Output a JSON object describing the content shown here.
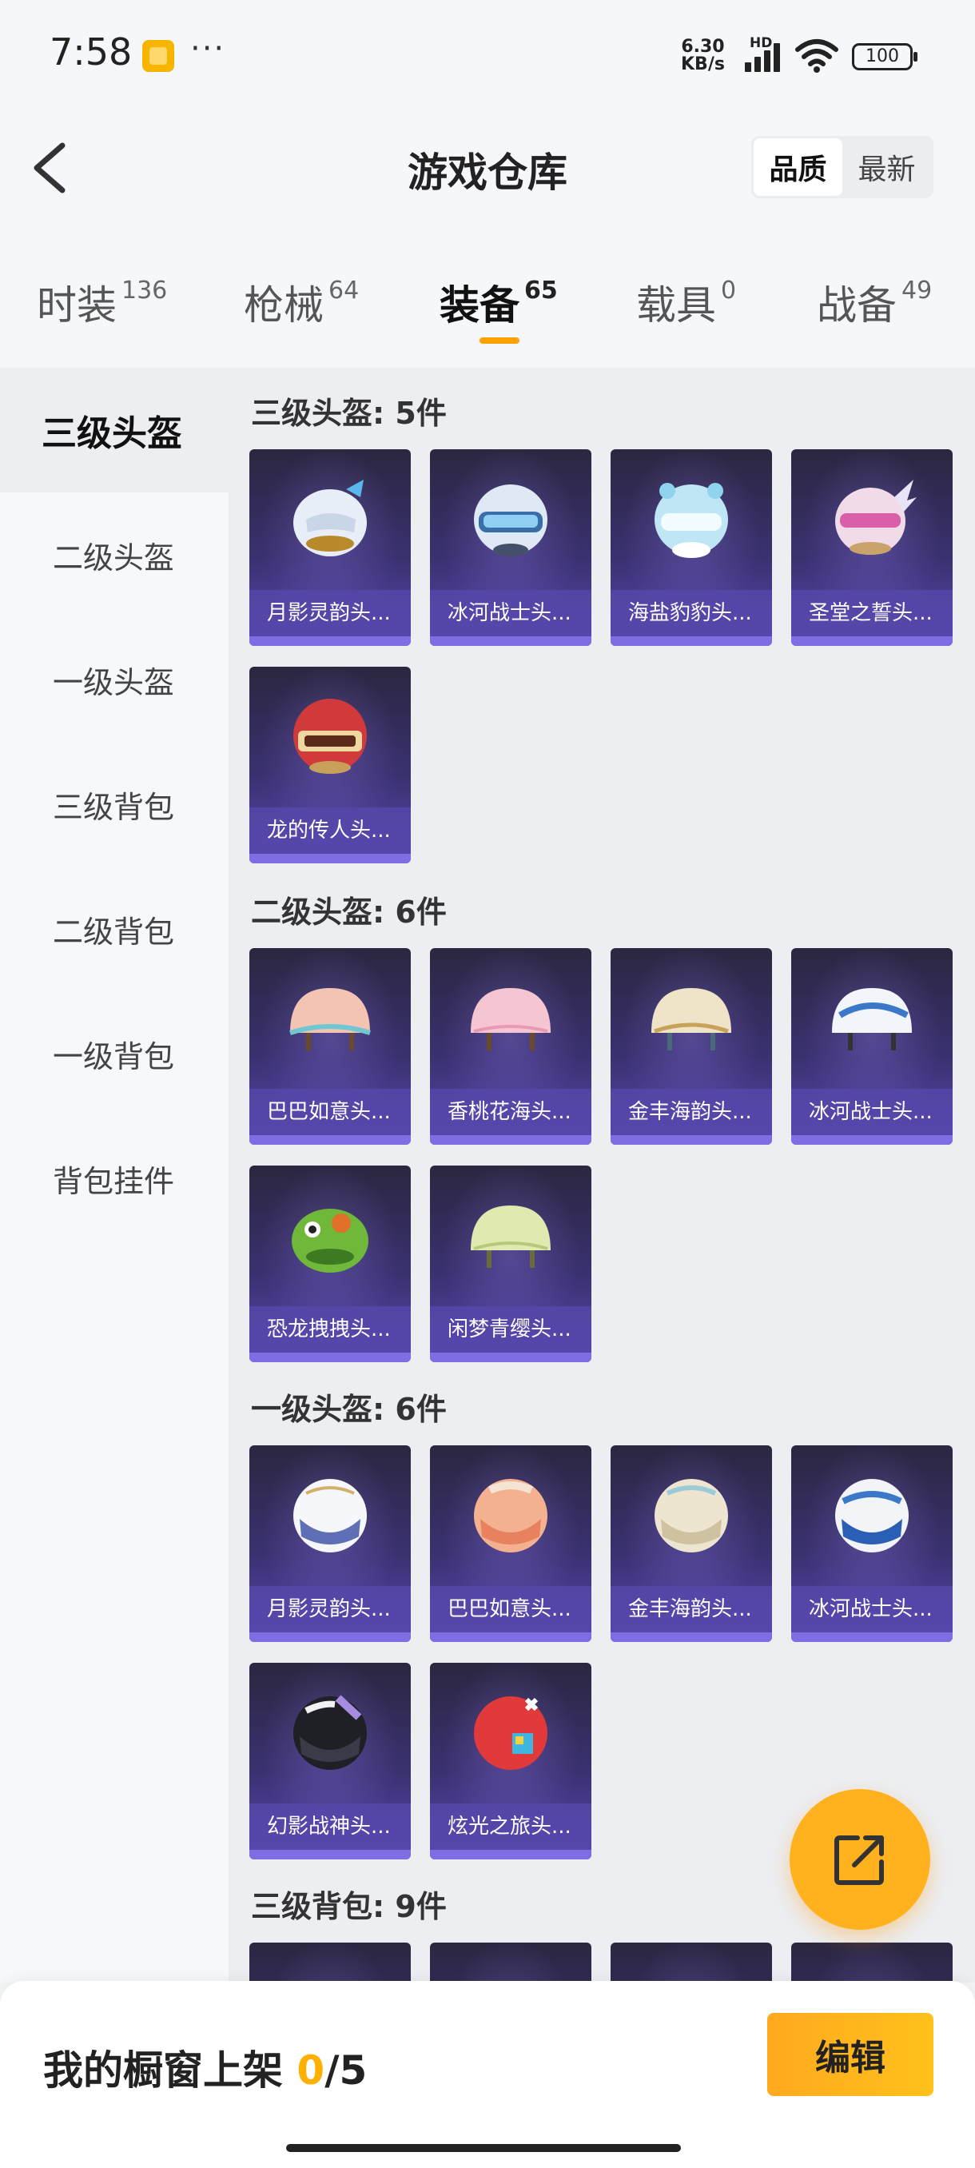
{
  "status_bar": {
    "time": "7:58",
    "dots": "···",
    "net_speed_value": "6.30",
    "net_speed_unit": "KB/s",
    "hd": "HD",
    "battery": "100"
  },
  "header": {
    "title": "游戏仓库",
    "sort_options": [
      {
        "label": "品质",
        "active": true
      },
      {
        "label": "最新",
        "active": false
      }
    ]
  },
  "tabs": [
    {
      "label": "时装",
      "count": "136",
      "active": false
    },
    {
      "label": "枪械",
      "count": "64",
      "active": false
    },
    {
      "label": "装备",
      "count": "65",
      "active": true
    },
    {
      "label": "载具",
      "count": "0",
      "active": false
    },
    {
      "label": "战备",
      "count": "49",
      "active": false
    }
  ],
  "sidebar": {
    "items": [
      {
        "label": "三级头盔",
        "active": true
      },
      {
        "label": "二级头盔",
        "active": false
      },
      {
        "label": "一级头盔",
        "active": false
      },
      {
        "label": "三级背包",
        "active": false
      },
      {
        "label": "二级背包",
        "active": false
      },
      {
        "label": "一级背包",
        "active": false
      },
      {
        "label": "背包挂件",
        "active": false
      }
    ]
  },
  "sections": [
    {
      "title": "三级头盔: 5件",
      "items": [
        {
          "name": "月影灵韵头...",
          "icon": "helmet-lvl3-white-blue"
        },
        {
          "name": "冰河战士头...",
          "icon": "helmet-lvl3-blue-visor"
        },
        {
          "name": "海盐豹豹头...",
          "icon": "helmet-lvl3-lightblue-cute"
        },
        {
          "name": "圣堂之誓头...",
          "icon": "helmet-lvl3-pink-winged"
        },
        {
          "name": "龙的传人头...",
          "icon": "helmet-lvl3-red-gold"
        }
      ]
    },
    {
      "title": "二级头盔: 6件",
      "items": [
        {
          "name": "巴巴如意头...",
          "icon": "helmet-lvl2-peach"
        },
        {
          "name": "香桃花海头...",
          "icon": "helmet-lvl2-pink"
        },
        {
          "name": "金丰海韵头...",
          "icon": "helmet-lvl2-cream-gold"
        },
        {
          "name": "冰河战士头...",
          "icon": "helmet-lvl2-white-blue"
        },
        {
          "name": "恐龙拽拽头...",
          "icon": "helmet-lvl2-green-dino"
        },
        {
          "name": "闲梦青缨头...",
          "icon": "helmet-lvl2-lightgreen"
        }
      ]
    },
    {
      "title": "一级头盔: 6件",
      "items": [
        {
          "name": "月影灵韵头...",
          "icon": "helmet-lvl1-white"
        },
        {
          "name": "巴巴如意头...",
          "icon": "helmet-lvl1-peach"
        },
        {
          "name": "金丰海韵头...",
          "icon": "helmet-lvl1-cream"
        },
        {
          "name": "冰河战士头...",
          "icon": "helmet-lvl1-blue-white"
        },
        {
          "name": "幻影战神头...",
          "icon": "helmet-lvl1-black-purple"
        },
        {
          "name": "炫光之旅头...",
          "icon": "helmet-lvl1-red-colorful"
        }
      ]
    },
    {
      "title": "三级背包: 9件",
      "items": [
        {
          "name": "",
          "icon": "backpack-lvl3"
        },
        {
          "name": "",
          "icon": "backpack-lvl3"
        },
        {
          "name": "",
          "icon": "backpack-lvl3"
        },
        {
          "name": "",
          "icon": "backpack-lvl3"
        }
      ]
    }
  ],
  "bottom_bar": {
    "label": "我的橱窗上架 ",
    "count_current": "0",
    "count_total": "/5",
    "edit_label": "编辑"
  },
  "colors": {
    "accent": "#ffb000",
    "card_top": "#2b2740",
    "card_bottom": "#5a48b3",
    "tab_underline": "#ffa200"
  }
}
